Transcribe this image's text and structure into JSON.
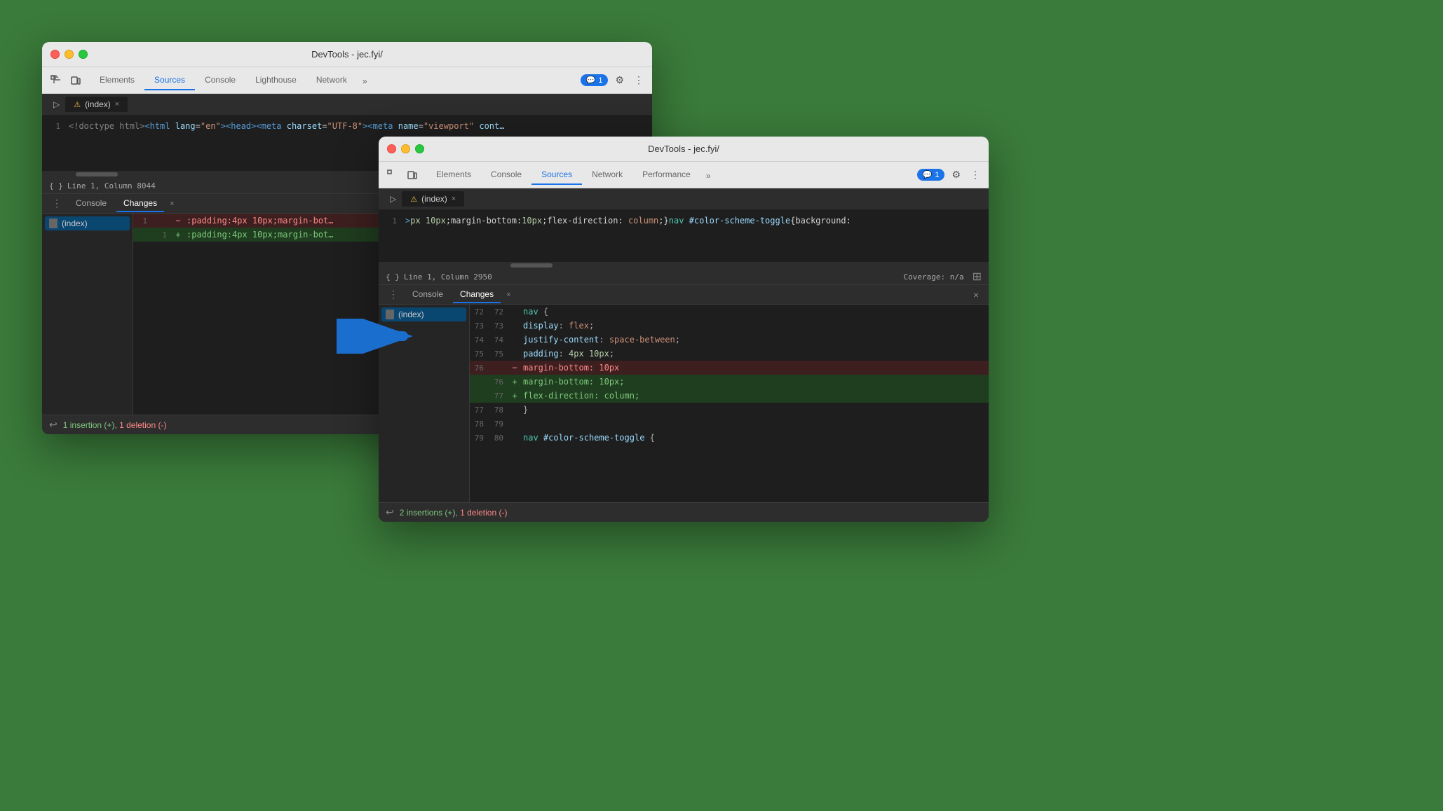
{
  "window1": {
    "title": "DevTools - jec.fyi/",
    "tabs": [
      {
        "label": "Elements",
        "active": false
      },
      {
        "label": "Sources",
        "active": true
      },
      {
        "label": "Console",
        "active": false
      },
      {
        "label": "Lighthouse",
        "active": false
      },
      {
        "label": "Network",
        "active": false
      }
    ],
    "more_tabs": "»",
    "file_tab": "(index)",
    "file_warning": "⚠",
    "code_line": "<!doctype html><html lang=\"en\"><head><meta charset=\"UTF-8\"><meta name=\"viewport\" cont…",
    "line_info": "Line 1, Column 8044",
    "panel": {
      "tabs": [
        {
          "label": "Console",
          "active": false
        },
        {
          "label": "Changes",
          "active": true
        }
      ],
      "file": "(index)",
      "diff_lines": [
        {
          "old_num": "1",
          "new_num": "",
          "marker": "−",
          "type": "deleted",
          "text": ":padding:4px 10px;margin-bot…"
        },
        {
          "old_num": "",
          "new_num": "1",
          "marker": "+",
          "type": "added",
          "text": ":padding:4px 10px;margin-bot…"
        }
      ],
      "footer_text": "1 insertion (+), 1 deletion (-)",
      "undo_label": "↩"
    }
  },
  "window2": {
    "title": "DevTools - jec.fyi/",
    "tabs": [
      {
        "label": "Elements",
        "active": false
      },
      {
        "label": "Console",
        "active": false
      },
      {
        "label": "Sources",
        "active": true
      },
      {
        "label": "Network",
        "active": false
      },
      {
        "label": "Performance",
        "active": false
      }
    ],
    "more_tabs": "»",
    "file_tab": "(index)",
    "file_warning": "⚠",
    "code_line": ">px 10px;margin-bottom:10px;flex-direction: column;}nav #color-scheme-toggle{background:…",
    "line_info": "Line 1, Column 2950",
    "coverage": "Coverage: n/a",
    "panel": {
      "tabs": [
        {
          "label": "Console",
          "active": false
        },
        {
          "label": "Changes",
          "active": true
        }
      ],
      "file": "(index)",
      "diff_lines": [
        {
          "old_num": "72",
          "new_num": "72",
          "marker": "",
          "type": "context",
          "text": "    nav {"
        },
        {
          "old_num": "73",
          "new_num": "73",
          "marker": "",
          "type": "context",
          "text": "        display: flex;"
        },
        {
          "old_num": "74",
          "new_num": "74",
          "marker": "",
          "type": "context",
          "text": "        justify-content: space-between;"
        },
        {
          "old_num": "75",
          "new_num": "75",
          "marker": "",
          "type": "context",
          "text": "        padding: 4px 10px;"
        },
        {
          "old_num": "76",
          "new_num": "",
          "marker": "−",
          "type": "deleted",
          "text": "        margin-bottom: 10px"
        },
        {
          "old_num": "",
          "new_num": "76",
          "marker": "+",
          "type": "added",
          "text": "        margin-bottom: 10px;"
        },
        {
          "old_num": "",
          "new_num": "77",
          "marker": "+",
          "type": "added",
          "text": "        flex-direction: column;"
        },
        {
          "old_num": "77",
          "new_num": "78",
          "marker": "",
          "type": "context",
          "text": "    }"
        },
        {
          "old_num": "78",
          "new_num": "79",
          "marker": "",
          "type": "context",
          "text": ""
        },
        {
          "old_num": "79",
          "new_num": "80",
          "marker": "",
          "type": "context",
          "text": "    nav #color-scheme-toggle {"
        }
      ],
      "footer_text": "2 insertions (+), 1 deletion (-)"
    }
  },
  "arrow": {
    "color": "#1a6fce"
  }
}
